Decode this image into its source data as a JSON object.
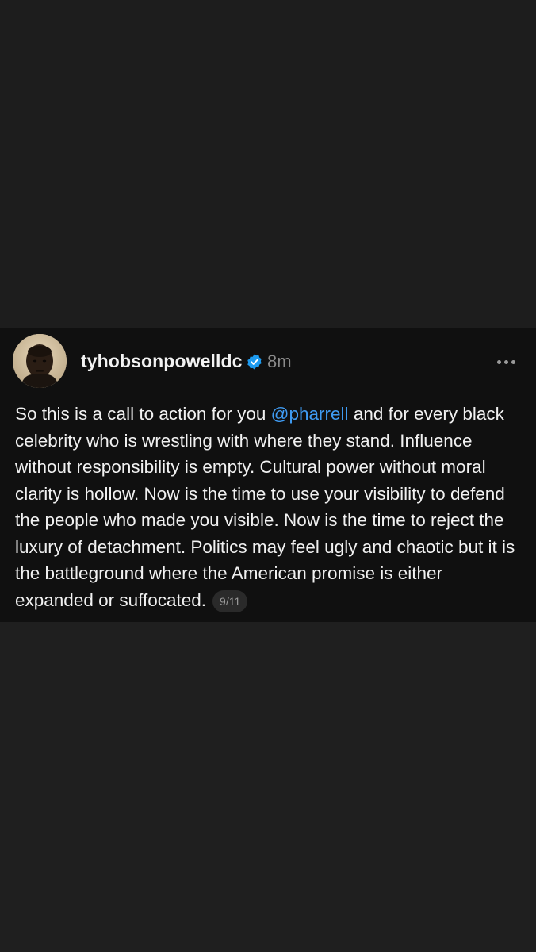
{
  "post": {
    "username": "tyhobsonpowelldc",
    "timestamp": "8m",
    "text_before_mention": "So this is a call to action for you ",
    "mention": "@pharrell",
    "text_after_mention": " and for every black celebrity who is wrestling with where they stand. Influence without responsibility is empty. Cultural power without moral clarity is hollow. Now is the time to use your visibility to defend the people who made you visible. Now is the time to reject the luxury of detachment. Politics may feel ugly and chaotic but it is the battleground where the American promise is either expanded or suffocated.",
    "thread_counter": "9/11"
  },
  "icons": {
    "verified": "verified-badge-icon",
    "more": "more-options-icon"
  },
  "colors": {
    "mention": "#3f9bf2",
    "verified_badge": "#1d9bf0",
    "card_background": "#101010",
    "page_background": "#1f1f1f"
  }
}
